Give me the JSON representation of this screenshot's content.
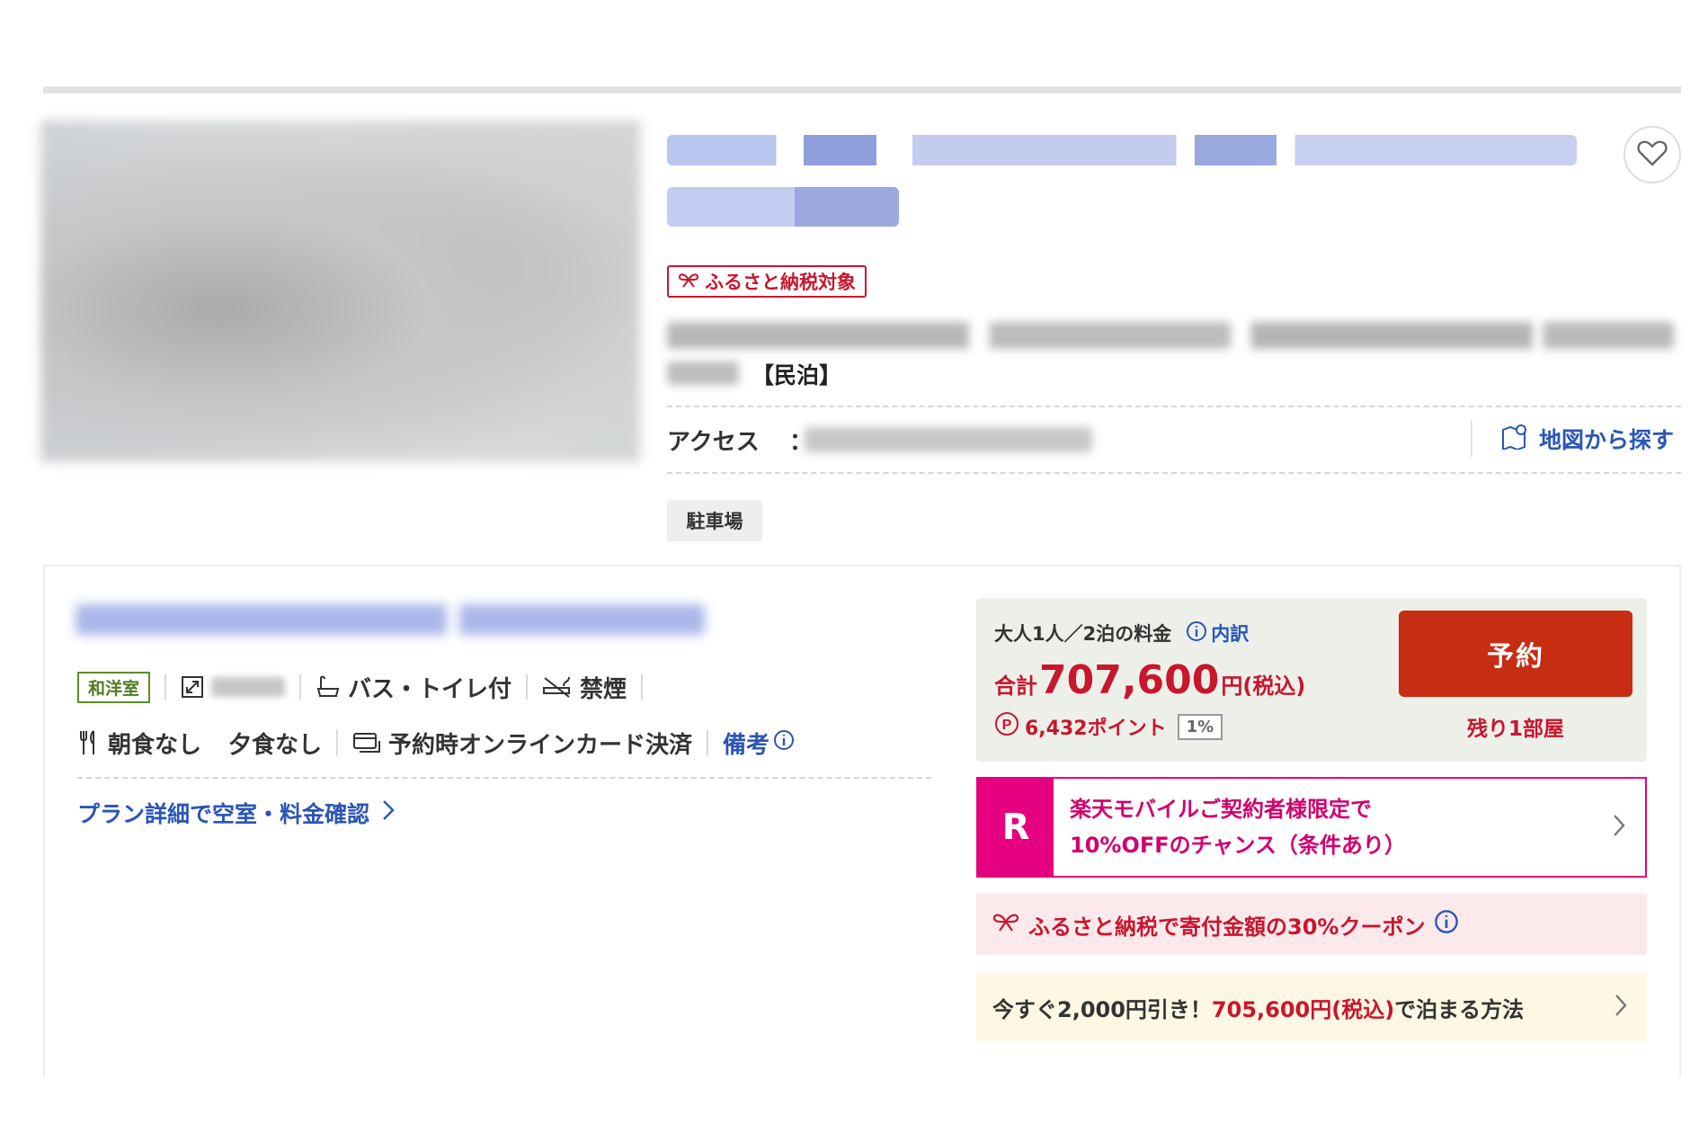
{
  "listing": {
    "furusato_badge": "ふるさと納税対象",
    "category": "【民泊】",
    "access_label": "アクセス",
    "access_colon": "：",
    "map_link": "地図から探す",
    "tag_parking": "駐車場"
  },
  "plan": {
    "room_type": "和洋室",
    "bath_toilet": "バス・トイレ付",
    "smoking": "禁煙",
    "breakfast": "朝食なし",
    "dinner": "夕食なし",
    "payment": "予約時オンラインカード決済",
    "notes": "備考",
    "detail_link": "プラン詳細で空室・料金確認"
  },
  "price": {
    "guests_nights": "大人1人／2泊の料金",
    "breakdown": "内訳",
    "total_label": "合計",
    "total_amount": "707,600",
    "total_suffix": "円(税込)",
    "points": "6,432ポイント",
    "point_rate": "1%",
    "reserve_button": "予約",
    "remaining": "残り1部屋"
  },
  "banners": {
    "mobile_logo": "R",
    "mobile_line1": "楽天モバイルご契約者様限定で",
    "mobile_line2": "10%OFFのチャンス（条件あり）",
    "coupon": "ふるさと納税で寄付金額の30%クーポン",
    "discount_prefix": "今すぐ2,000円引き！",
    "discount_price": "705,600円(税込)",
    "discount_suffix": "で泊まる方法"
  },
  "colors": {
    "accent_red": "#c8162d",
    "reserve_button": "#c62d12",
    "link_blue": "#2a55b5",
    "rakuten_magenta": "#e4007f",
    "room_type_green": "#4f7d22"
  },
  "icons": [
    "heart-icon",
    "gift-ribbon-icon",
    "map-pin-icon",
    "resize-icon",
    "bath-icon",
    "no-smoking-icon",
    "cutlery-icon",
    "card-payment-icon",
    "info-icon",
    "point-icon",
    "chevron-right-icon"
  ]
}
